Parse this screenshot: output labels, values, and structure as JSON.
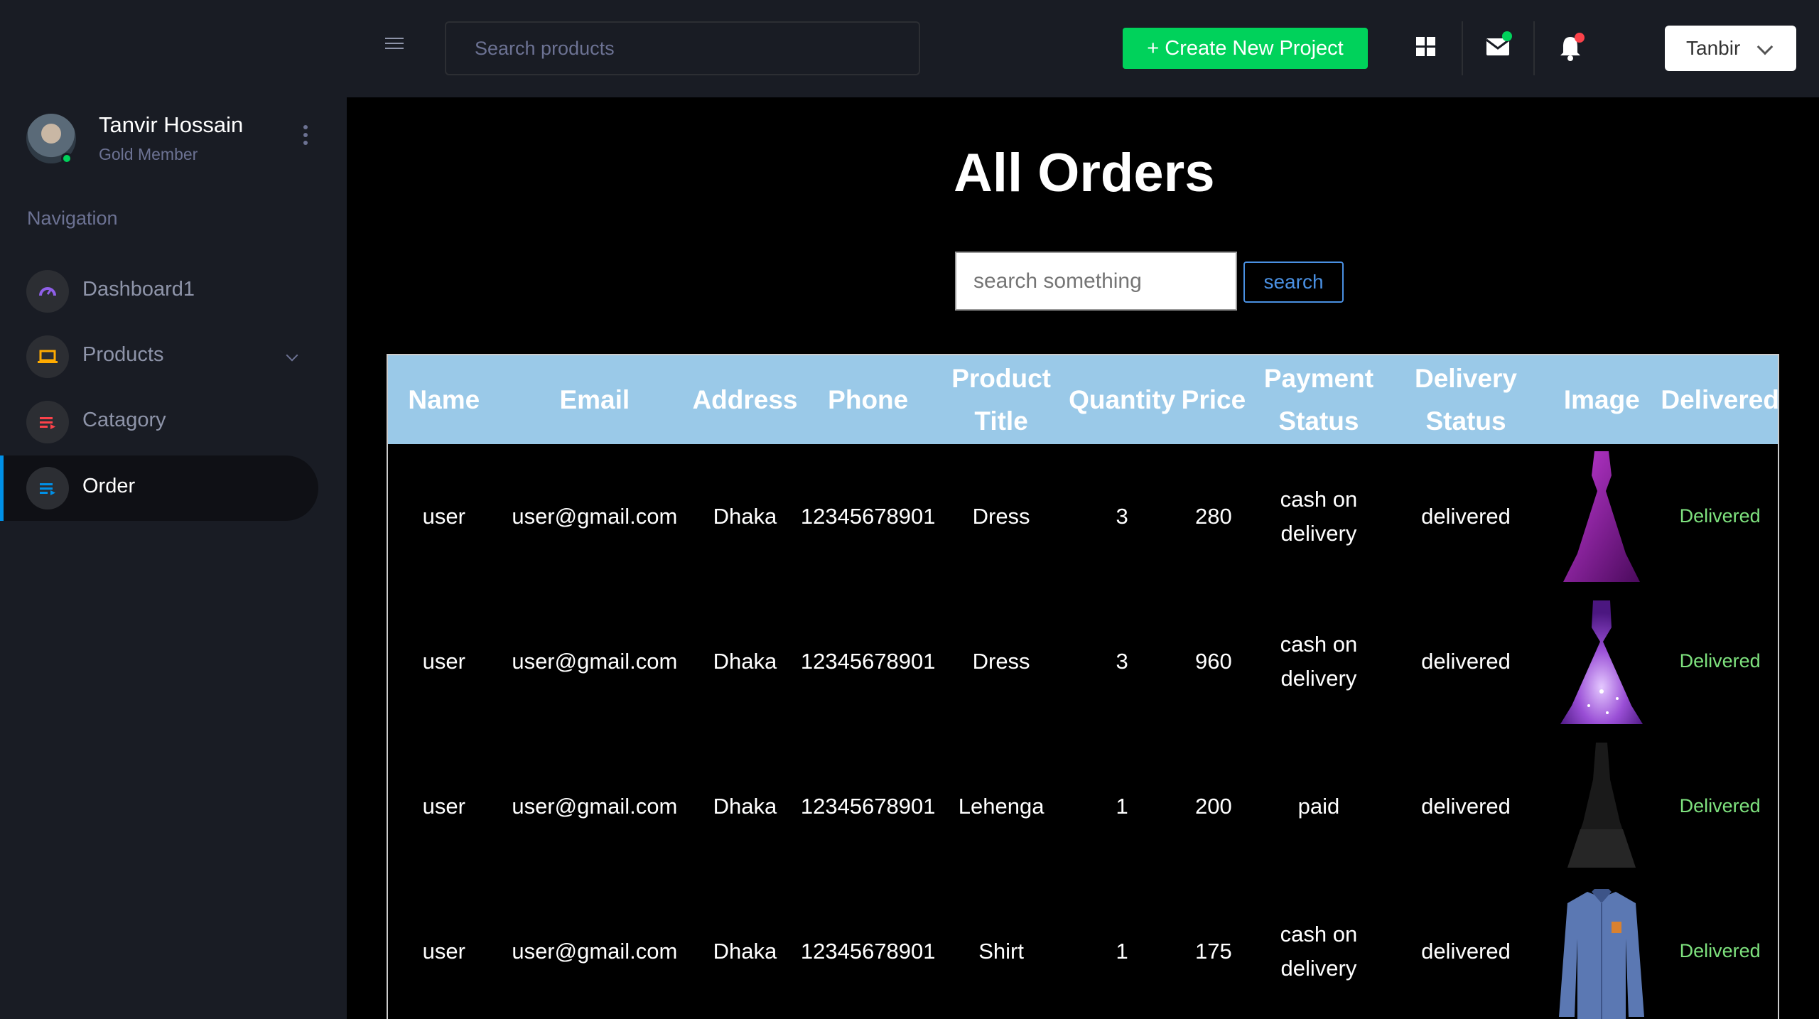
{
  "topbar": {
    "search_placeholder": "Search products",
    "create_button": "+ Create New Project",
    "user_menu": "Tanbir",
    "colors": {
      "accent_green": "#00d25b",
      "notify_red": "#fc424a"
    }
  },
  "profile": {
    "name": "Tanvir Hossain",
    "rank": "Gold Member"
  },
  "navigation": {
    "heading": "Navigation",
    "items": [
      {
        "label": "Dashboard1",
        "icon": "speedometer-icon",
        "color": "#8f5fe8"
      },
      {
        "label": "Products",
        "icon": "laptop-icon",
        "color": "#ffab00"
      },
      {
        "label": "Catagory",
        "icon": "list-icon",
        "color": "#fc424a"
      },
      {
        "label": "Order",
        "icon": "list-icon",
        "color": "#0090e7",
        "active": true
      }
    ]
  },
  "page": {
    "title": "All Orders",
    "search_placeholder": "search something",
    "search_button": "search"
  },
  "table": {
    "headers": [
      "Name",
      "Email",
      "Address",
      "Phone",
      "Product Title",
      "Quantity",
      "Price",
      "Payment Status",
      "Delivery Status",
      "Image",
      "Delivered"
    ],
    "rows": [
      {
        "name": "user",
        "email": "user@gmail.com",
        "address": "Dhaka",
        "phone": "12345678901",
        "title": "Dress",
        "quantity": "3",
        "price": "280",
        "payment": "cash on delivery",
        "delivery": "delivered",
        "image": "purple-gown-image",
        "delivered": "Delivered"
      },
      {
        "name": "user",
        "email": "user@gmail.com",
        "address": "Dhaka",
        "phone": "12345678901",
        "title": "Dress",
        "quantity": "3",
        "price": "960",
        "payment": "cash on delivery",
        "delivery": "delivered",
        "image": "sparkle-gown-image",
        "delivered": "Delivered"
      },
      {
        "name": "user",
        "email": "user@gmail.com",
        "address": "Dhaka",
        "phone": "12345678901",
        "title": "Lehenga",
        "quantity": "1",
        "price": "200",
        "payment": "paid",
        "delivery": "delivered",
        "image": "black-lehenga-image",
        "delivered": "Delivered"
      },
      {
        "name": "user",
        "email": "user@gmail.com",
        "address": "Dhaka",
        "phone": "12345678901",
        "title": "Shirt",
        "quantity": "1",
        "price": "175",
        "payment": "cash on delivery",
        "delivery": "delivered",
        "image": "blue-shirt-image",
        "delivered": "Delivered"
      }
    ]
  }
}
